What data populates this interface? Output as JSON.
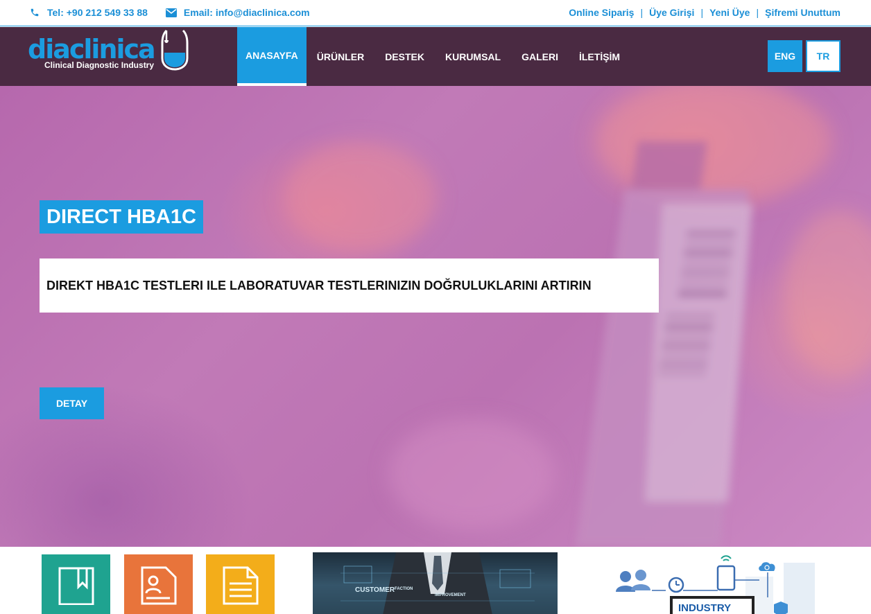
{
  "topbar": {
    "phone": "Tel: +90 212 549 33 88",
    "email": "Email: info@diaclinica.com",
    "links": [
      "Online Sipariş",
      "Üye Girişi",
      "Yeni Üye",
      "Şifremi Unuttum"
    ],
    "separator": "|"
  },
  "header": {
    "logo_text": "diaclinica",
    "logo_tagline": "Clinical Diagnostic Industry",
    "nav": [
      "ANASAYFA",
      "ÜRÜNLER",
      "DESTEK",
      "KURUMSAL",
      "GALERI",
      "İLETİŞİM"
    ],
    "lang_eng": "ENG",
    "lang_tr": "TR"
  },
  "hero": {
    "title": "DIRECT HBA1C",
    "subtitle": "DIREKT HBA1C TESTLERI ILE LABORATUVAR TESTLERINIZIN DOĞRULUKLARINI ARTIRIN",
    "button": "DETAY"
  },
  "bottom": {
    "photo_words": [
      "CUSTOMER",
      "FACTION",
      "IMPROVEMENT"
    ],
    "industry_label": "INDUSTRY"
  },
  "colors": {
    "accent": "#1b9ce0",
    "header_bg": "#4a2a42",
    "tile_green": "#1fa390",
    "tile_orange": "#e8743b",
    "tile_yellow": "#f3ad1a"
  },
  "icons": [
    "phone-icon",
    "envelope-icon",
    "bookmark-book-icon",
    "resume-document-icon",
    "text-document-icon"
  ]
}
